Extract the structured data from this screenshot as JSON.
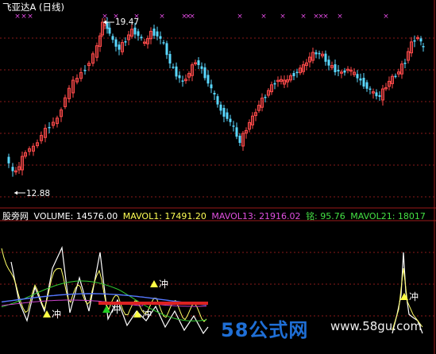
{
  "window": {
    "title": "飞亚达A (日线)"
  },
  "price_panel": {
    "high_label": "19.47",
    "low_label": "12.88",
    "marker_glyph": "×",
    "colors": {
      "up": "#ff4a4a",
      "down": "#5ad8ff",
      "grid": "#8a1a1a",
      "marker": "#e04be0"
    }
  },
  "indicator_panel": {
    "label": "股旁网",
    "volume": {
      "label": "VOLUME:",
      "value": "14576.00",
      "color": "#ffffff"
    },
    "mavol1": {
      "label": "MAVOL1:",
      "value": "17491.20",
      "color": "#ffff55"
    },
    "mavol13": {
      "label": "MAVOL13:",
      "value": "21916.02",
      "color": "#e050e0"
    },
    "ming": {
      "label": "铭:",
      "value": "95.76",
      "color": "#44e044"
    },
    "mavol21": {
      "label": "MAVOL21:",
      "value": "18017",
      "color": "#44e044"
    },
    "signal_text": "冲",
    "colors": {
      "line_white": "#ffffff",
      "line_yellow": "#ffff66",
      "line_green": "#33cc33",
      "line_blue": "#5577ff",
      "line_purple": "#cc44cc",
      "bar_red": "#dd2222",
      "signal_up": "#ffff44",
      "signal_green": "#22cc22"
    }
  },
  "watermark": {
    "brand": "58公式网",
    "url": "www.58gu.com"
  }
}
